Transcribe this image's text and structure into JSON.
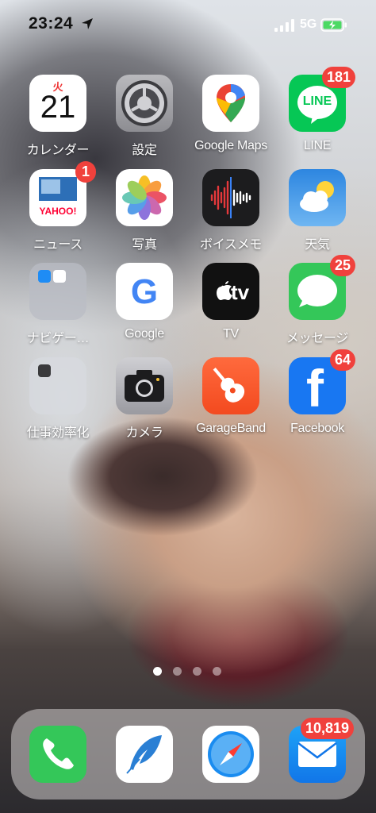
{
  "status_bar": {
    "time": "23:24",
    "network": "5G"
  },
  "apps": [
    {
      "id": "calendar",
      "label": "カレンダー",
      "weekday": "火",
      "day": "21"
    },
    {
      "id": "settings",
      "label": "設定"
    },
    {
      "id": "google-maps",
      "label": "Google Maps"
    },
    {
      "id": "line",
      "label": "LINE",
      "badge": "181",
      "icon_text": "LINE"
    },
    {
      "id": "news",
      "label": "ニュース",
      "badge": "1",
      "icon_text": "YAHOO!"
    },
    {
      "id": "photos",
      "label": "写真"
    },
    {
      "id": "voice-memos",
      "label": "ボイスメモ"
    },
    {
      "id": "weather",
      "label": "天気"
    },
    {
      "id": "navigation-folder",
      "label": "ナビゲー…"
    },
    {
      "id": "google",
      "label": "Google",
      "icon_text": "G"
    },
    {
      "id": "tv",
      "label": "TV",
      "icon_text": "tv"
    },
    {
      "id": "messages",
      "label": "メッセージ",
      "badge": "25"
    },
    {
      "id": "productivity-folder",
      "label": "仕事効率化"
    },
    {
      "id": "camera",
      "label": "カメラ"
    },
    {
      "id": "garageband",
      "label": "GarageBand"
    },
    {
      "id": "facebook",
      "label": "Facebook",
      "badge": "64",
      "icon_text": "f"
    }
  ],
  "page_indicator": {
    "count": 4,
    "active": 0
  },
  "dock": [
    {
      "id": "phone"
    },
    {
      "id": "feather"
    },
    {
      "id": "safari"
    },
    {
      "id": "mail",
      "badge": "10,819"
    }
  ]
}
